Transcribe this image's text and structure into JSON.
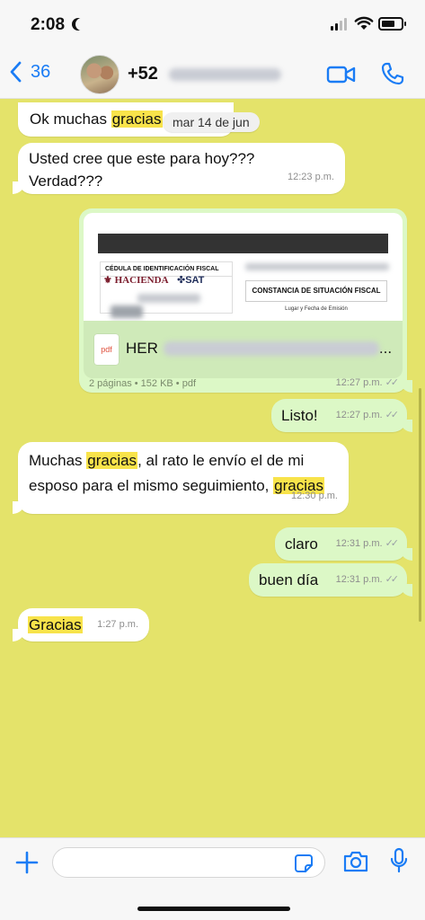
{
  "status": {
    "time": "2:08",
    "battery_level": 0.7
  },
  "header": {
    "back_count": "36",
    "contact_prefix": "+52",
    "icons": [
      "chevron-left-icon",
      "video-camera-icon",
      "phone-icon"
    ]
  },
  "chat": {
    "date_pill": "mar 14 de jun",
    "messages": [
      {
        "partial_text": "Ok muchas ",
        "highlight": "gracias"
      },
      {
        "text_line1": "Usted cree que este para hoy???",
        "text_line2": "Verdad???",
        "time": "12:23 p.m."
      },
      {
        "doc_header": "CÉDULA DE IDENTIFICACIÓN FISCAL",
        "hacienda": "HACIENDA",
        "sat": "SAT",
        "constancia": "CONSTANCIA DE SITUACIÓN FISCAL",
        "lugar": "Lugar y Fecha de Emisión",
        "pdf_label": "pdf",
        "name_prefix": "HER",
        "ellipsis": "...",
        "info": "2 páginas • 152 KB • pdf",
        "time": "12:27 p.m."
      },
      {
        "text": "Listo!",
        "time": "12:27 p.m."
      },
      {
        "w1": "Muchas ",
        "h1": "gracias",
        "w2": ", al rato le envío el de mi",
        "w3": "esposo para el mismo seguimiento, ",
        "h2": "gracias",
        "time": "12:30 p.m."
      },
      {
        "text": "claro",
        "time": "12:31 p.m."
      },
      {
        "text": "buen día",
        "time": "12:31 p.m."
      },
      {
        "highlight": "Gracias",
        "time": "1:27 p.m."
      }
    ]
  },
  "bottom": {
    "icons": [
      "plus-icon",
      "sticker-icon",
      "camera-icon",
      "microphone-icon"
    ],
    "input_value": ""
  },
  "colors": {
    "chat_bg": "#e4e36a",
    "outgoing": "#dcf8c6",
    "incoming": "#ffffff",
    "accent": "#1a7cf5",
    "highlight": "#f8e34a"
  }
}
